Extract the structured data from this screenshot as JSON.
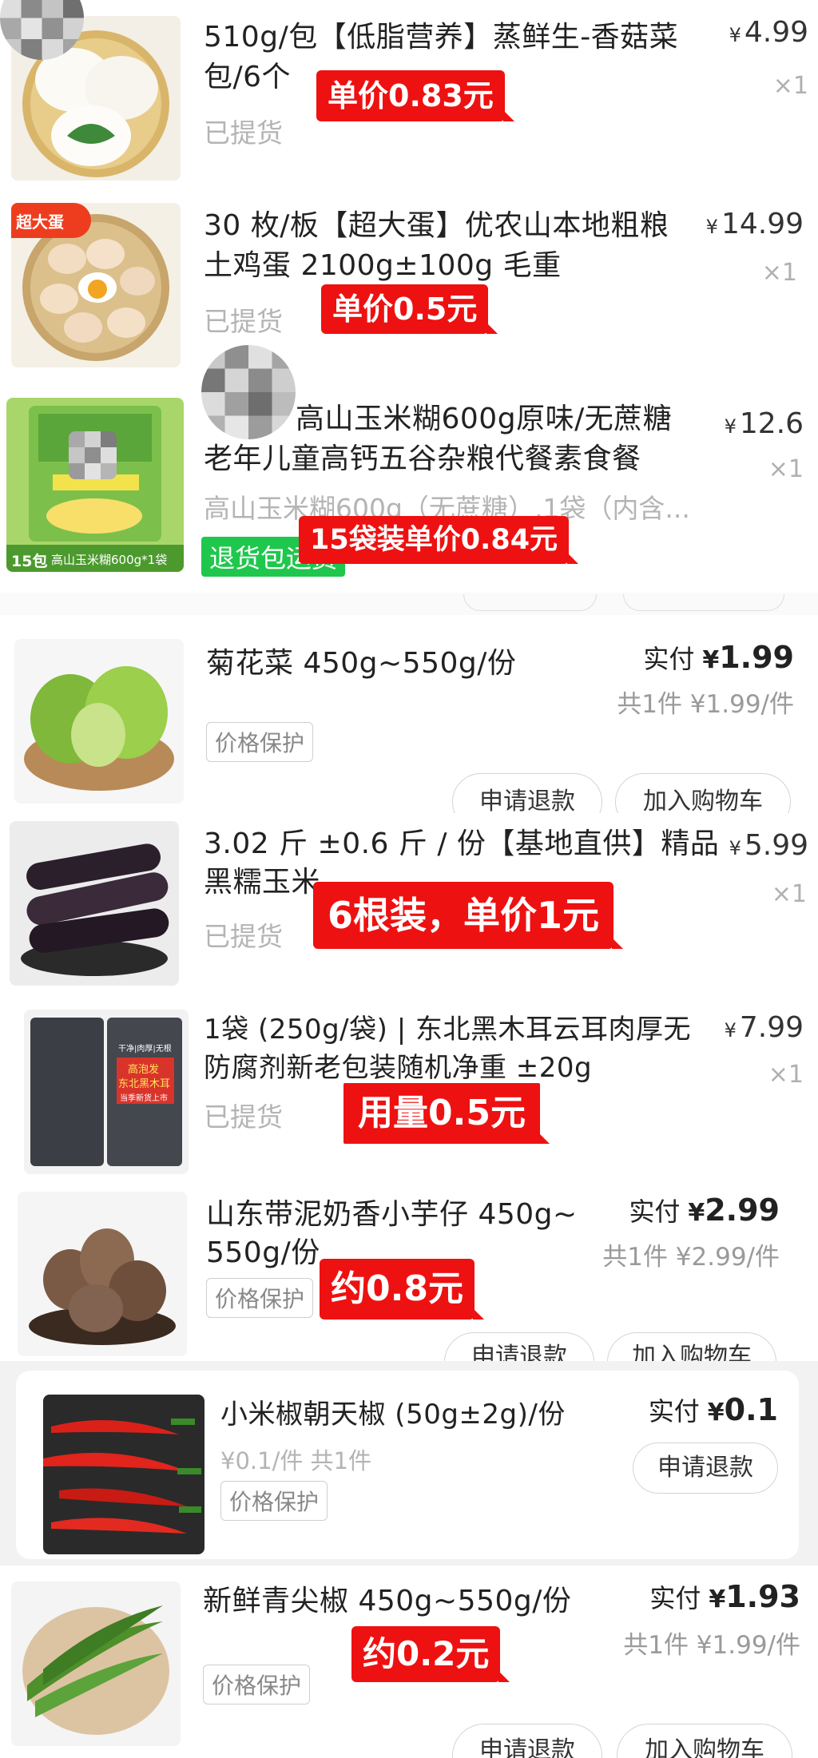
{
  "items": [
    {
      "title_l1": "510g/包【低脂营养】蒸鲜生-香菇菜",
      "title_l2": "包/6个",
      "status": "已提货",
      "price": "4.99",
      "qty": "×1",
      "label": "单价0.83元"
    },
    {
      "title_l1": "30 枚/板【超大蛋】优农山本地粗粮",
      "title_l2": "土鸡蛋 2100g±100g 毛重",
      "status": "已提货",
      "price": "14.99",
      "qty": "×1",
      "label": "单价0.5元",
      "thumb_badge": "超大蛋"
    },
    {
      "title_l1": "高山玉米糊600g原味/无蔗糖",
      "title_l2": "老年儿童高钙五谷杂粮代餐素食餐",
      "sub": "高山玉米糊600g（无蔗糖）,1袋（内含...",
      "price": "12.6",
      "qty": "×1",
      "status_green": "退货包运费",
      "label": "15袋装单价0.84元",
      "thumb_caption_left": "15包",
      "thumb_caption_right": "高山玉米糊600g*1袋"
    },
    {
      "title_l1": "菊花菜 450g~550g/份",
      "paid_label": "实付",
      "paid_value": "1.99",
      "each": "共1件 ¥1.99/件",
      "tag": "价格保护",
      "btn_refund": "申请退款",
      "btn_cart": "加入购物车"
    },
    {
      "title_l1": "3.02 斤 ±0.6 斤 / 份【基地直供】精品",
      "title_l2": "黑糯玉米",
      "status": "已提货",
      "price": "5.99",
      "qty": "×1",
      "label": "6根装，单价1元"
    },
    {
      "title_l1": "1袋 (250g/袋) | 东北黑木耳云耳肉厚无",
      "title_l2": "防腐剂新老包装随机净重 ±20g",
      "status": "已提货",
      "price": "7.99",
      "qty": "×1",
      "label": "用量0.5元",
      "thumb_tag1": "干净|肉厚|无根",
      "thumb_tag2": "高泡发",
      "thumb_tag3": "东北黑木耳",
      "thumb_tag4": "当季新货上市"
    },
    {
      "title_l1": "山东带泥奶香小芋仔 450g~",
      "title_l2": "550g/份",
      "paid_label": "实付",
      "paid_value": "2.99",
      "each": "共1件 ¥2.99/件",
      "tag": "价格保护",
      "label": "约0.8元",
      "btn_refund": "申请退款",
      "btn_cart": "加入购物车"
    },
    {
      "title_l1": "小米椒朝天椒 (50g±2g)/份",
      "sub": "¥0.1/件  共1件",
      "paid_label": "实付",
      "paid_value": "0.1",
      "tag": "价格保护",
      "btn_refund": "申请退款"
    },
    {
      "title_l1": "新鲜青尖椒 450g~550g/份",
      "paid_label": "实付",
      "paid_value": "1.93",
      "each": "共1件 ¥1.99/件",
      "tag": "价格保护",
      "label": "约0.2元",
      "btn_refund": "申请退款",
      "btn_cart": "加入购物车"
    }
  ],
  "currency": "¥",
  "colors": {
    "label_red": "#ee1111",
    "refund_green": "#1fc74d",
    "divider_gray": "#f4f4f4"
  }
}
